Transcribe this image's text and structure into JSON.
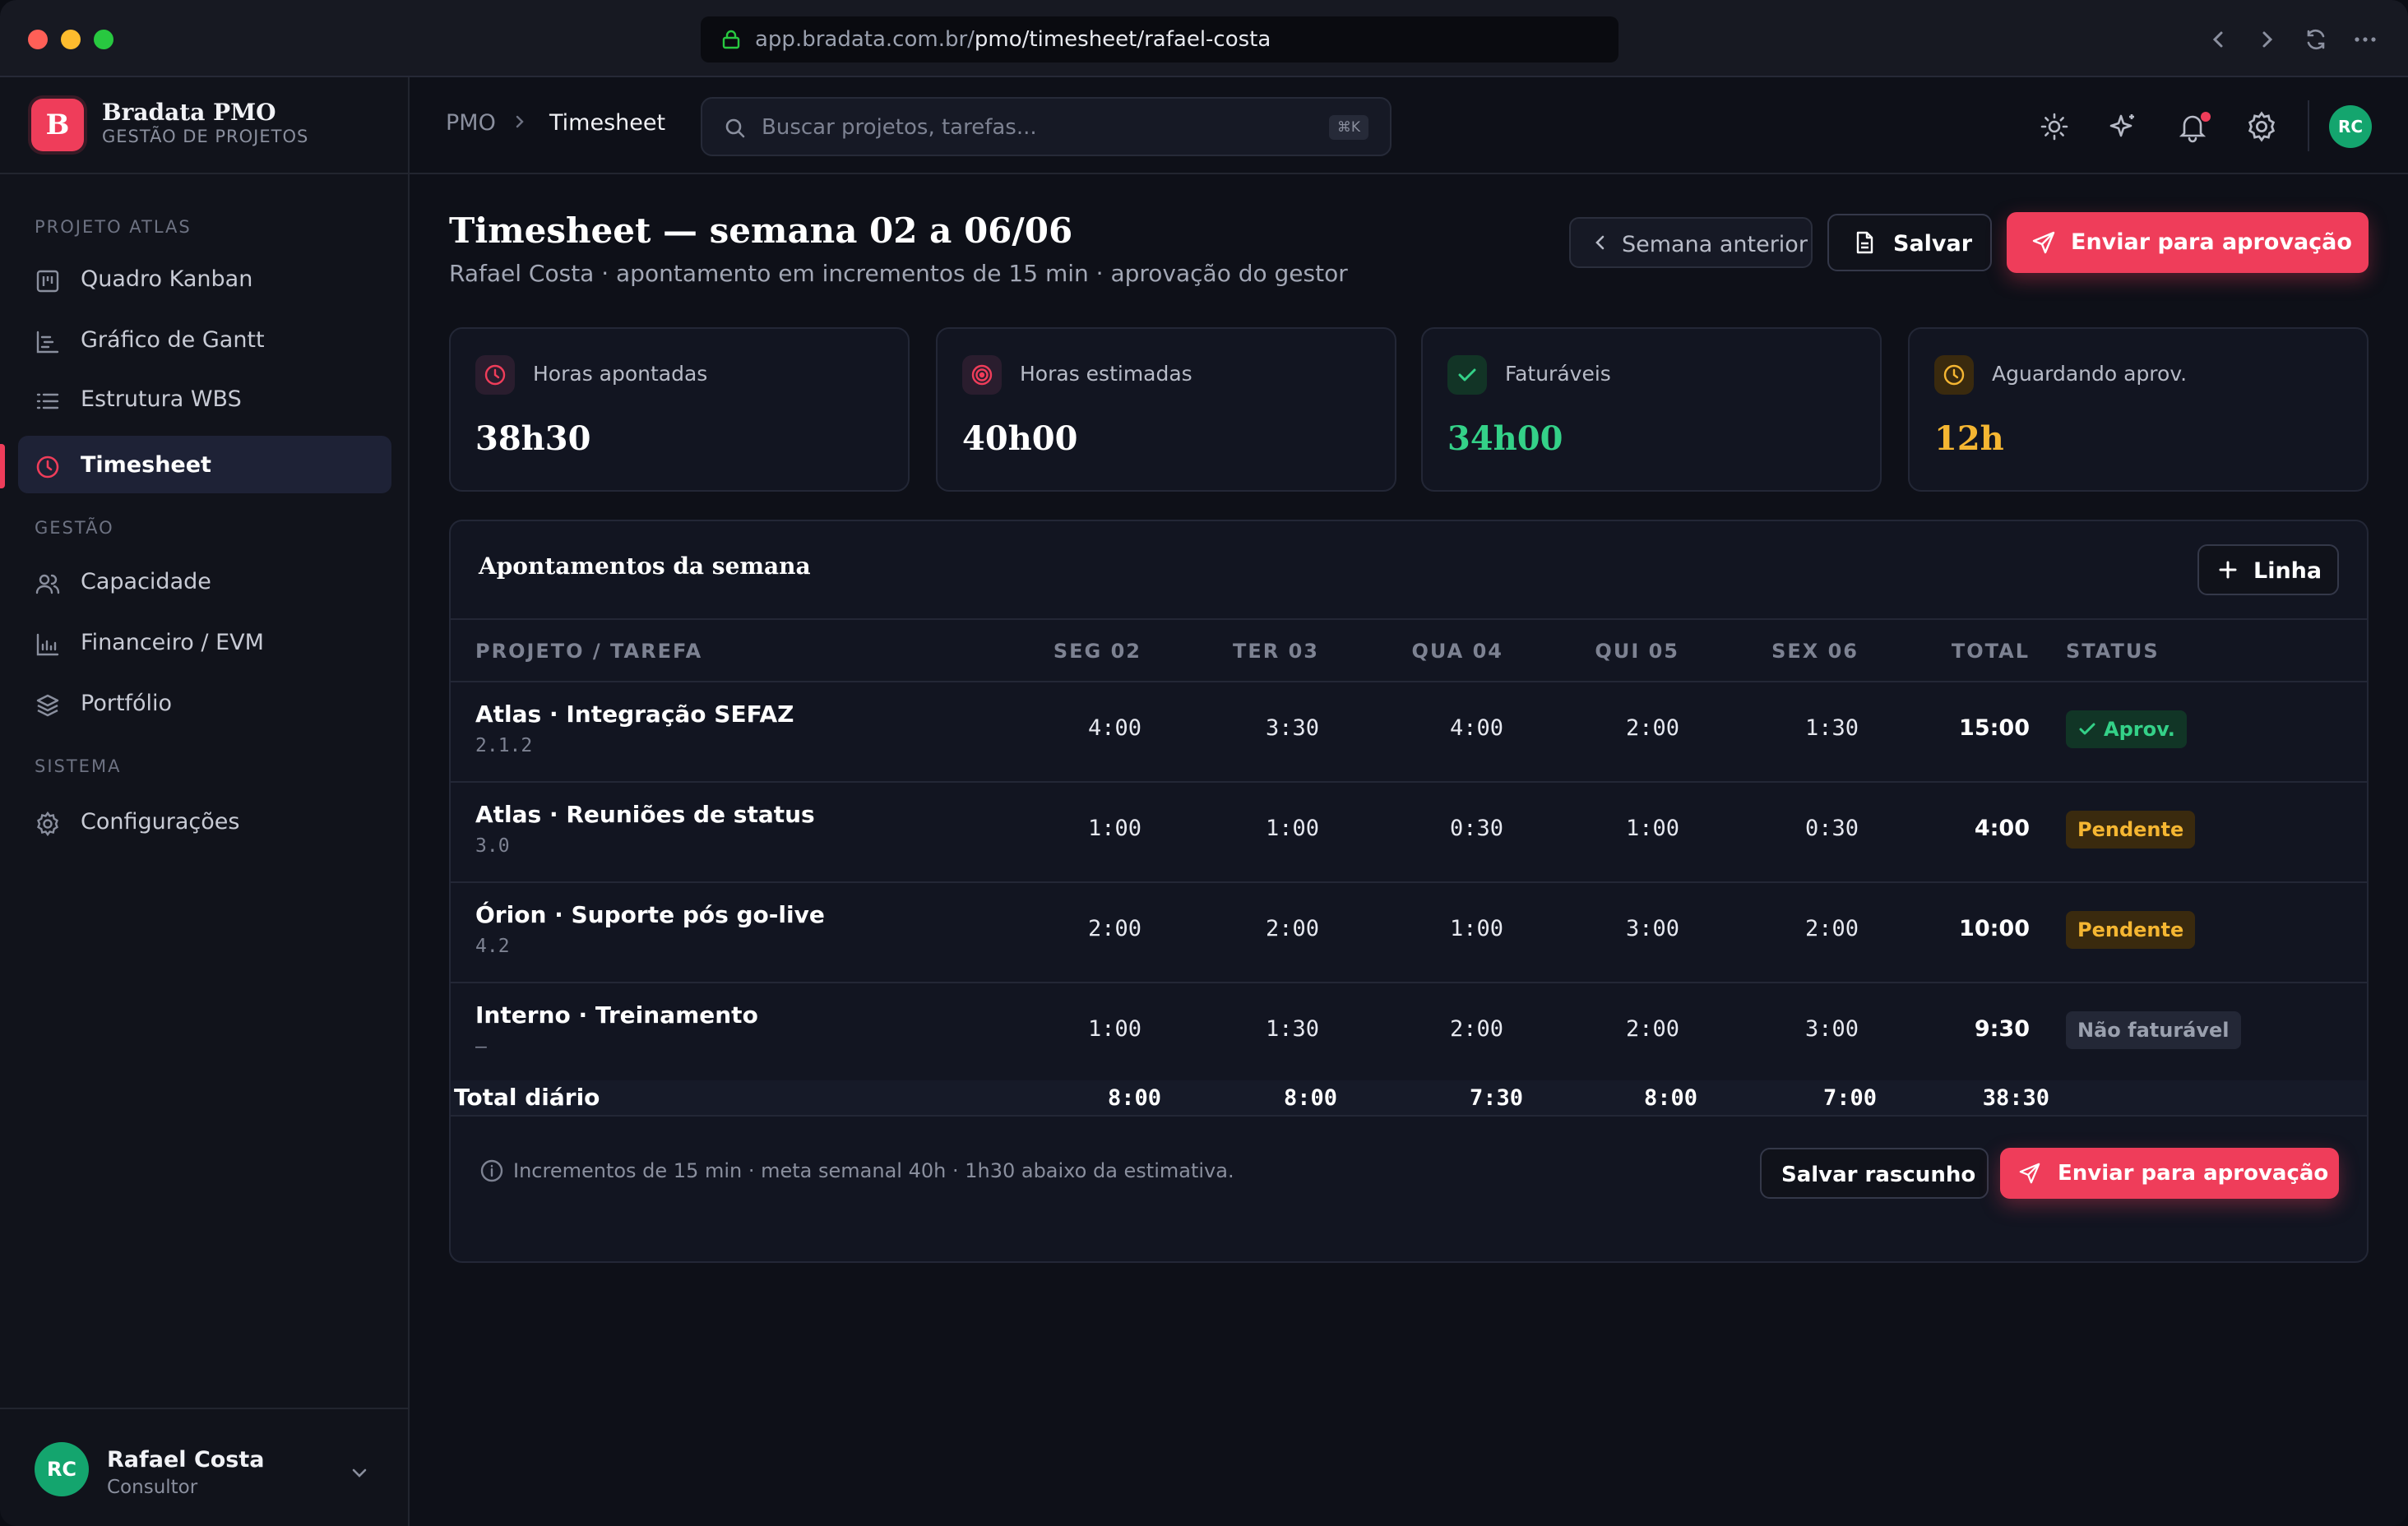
{
  "browser": {
    "url_host": "app.bradata.com.br/",
    "url_path": "pmo/timesheet/rafael-costa"
  },
  "brand": {
    "logo_letter": "B",
    "name": "Bradata PMO",
    "subtitle": "GESTÃO DE PROJETOS"
  },
  "sidebar": {
    "sections": [
      {
        "title": "PROJETO ATLAS",
        "items": [
          {
            "label": "Quadro Kanban",
            "icon": "kanban-icon"
          },
          {
            "label": "Gráfico de Gantt",
            "icon": "gantt-icon"
          },
          {
            "label": "Estrutura WBS",
            "icon": "list-icon"
          },
          {
            "label": "Timesheet",
            "icon": "clock-icon",
            "active": true
          }
        ]
      },
      {
        "title": "GESTÃO",
        "items": [
          {
            "label": "Capacidade",
            "icon": "users-icon"
          },
          {
            "label": "Financeiro / EVM",
            "icon": "bar-chart-icon"
          },
          {
            "label": "Portfólio",
            "icon": "layers-icon"
          }
        ]
      },
      {
        "title": "SISTEMA",
        "items": [
          {
            "label": "Configurações",
            "icon": "gear-icon"
          }
        ]
      }
    ],
    "user": {
      "initials": "RC",
      "name": "Rafael Costa",
      "role": "Consultor"
    }
  },
  "topbar": {
    "breadcrumb": [
      "PMO",
      "Timesheet"
    ],
    "search_placeholder": "Buscar projetos, tarefas...",
    "search_shortcut": "⌘K",
    "avatar_initials": "RC"
  },
  "page": {
    "title": "Timesheet — semana 02 a 06/06",
    "subtitle": "Rafael Costa · apontamento em incrementos de 15 min · aprovação do gestor",
    "btn_prev_week": "Semana anterior",
    "btn_save": "Salvar",
    "btn_submit": "Enviar para aprovação"
  },
  "kpis": [
    {
      "label": "Horas apontadas",
      "value": "38h30",
      "icon": "clock-icon",
      "color": "#ef3d5a",
      "value_color": "#ffffff"
    },
    {
      "label": "Horas estimadas",
      "value": "40h00",
      "icon": "target-icon",
      "color": "#ef3d5a",
      "value_color": "#ffffff"
    },
    {
      "label": "Faturáveis",
      "value": "34h00",
      "icon": "check-icon",
      "color": "#34d188",
      "value_color": "#34d188"
    },
    {
      "label": "Aguardando aprov.",
      "value": "12h",
      "icon": "clock-icon",
      "color": "#f5b632",
      "value_color": "#f5b632"
    }
  ],
  "table": {
    "title": "Apontamentos da semana",
    "add_line_label": "Linha",
    "headers": [
      "PROJETO / TAREFA",
      "SEG 02",
      "TER 03",
      "QUA 04",
      "QUI 05",
      "SEX 06",
      "TOTAL",
      "STATUS"
    ],
    "rows": [
      {
        "task": "Atlas · Integração SEFAZ",
        "code": "2.1.2",
        "days": [
          "4:00",
          "3:30",
          "4:00",
          "2:00",
          "1:30"
        ],
        "total": "15:00",
        "status": "Aprov.",
        "status_kind": "ok"
      },
      {
        "task": "Atlas · Reuniões de status",
        "code": "3.0",
        "days": [
          "1:00",
          "1:00",
          "0:30",
          "1:00",
          "0:30"
        ],
        "total": "4:00",
        "status": "Pendente",
        "status_kind": "pend"
      },
      {
        "task": "Órion · Suporte pós go-live",
        "code": "4.2",
        "days": [
          "2:00",
          "2:00",
          "1:00",
          "3:00",
          "2:00"
        ],
        "total": "10:00",
        "status": "Pendente",
        "status_kind": "pend"
      },
      {
        "task": "Interno · Treinamento",
        "code": "—",
        "days": [
          "1:00",
          "1:30",
          "2:00",
          "2:00",
          "3:00"
        ],
        "total": "9:30",
        "status": "Não faturável",
        "status_kind": "nf"
      }
    ],
    "footer": {
      "label": "Total diário",
      "days": [
        "8:00",
        "8:00",
        "7:30",
        "8:00",
        "7:00"
      ],
      "total": "38:30"
    },
    "note": "Incrementos de 15 min · meta semanal 40h · 1h30 abaixo da estimativa.",
    "btn_draft": "Salvar rascunho",
    "btn_submit": "Enviar para aprovação"
  }
}
